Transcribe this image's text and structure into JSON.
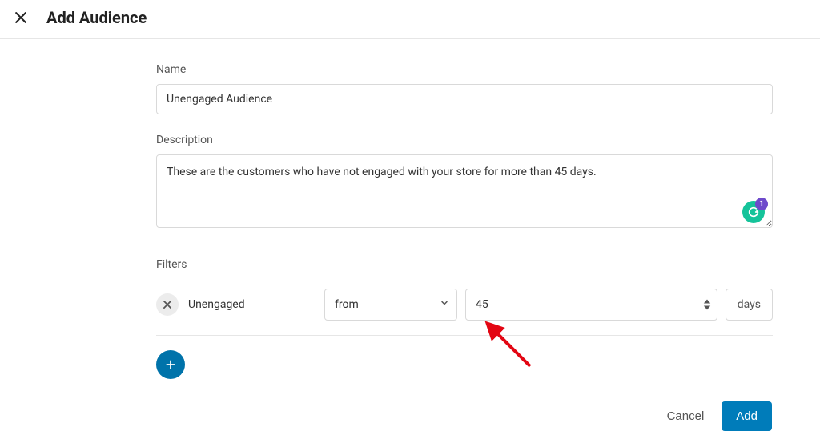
{
  "header": {
    "title": "Add Audience"
  },
  "form": {
    "name_label": "Name",
    "name_value": "Unengaged Audience",
    "description_label": "Description",
    "description_value": "These are the customers who have not engaged with your store for more than 45 days.",
    "filters_label": "Filters",
    "filter": {
      "name": "Unengaged",
      "operator": "from",
      "value": "45",
      "unit": "days"
    }
  },
  "grammarly": {
    "count": "1"
  },
  "footer": {
    "cancel_label": "Cancel",
    "add_label": "Add"
  }
}
